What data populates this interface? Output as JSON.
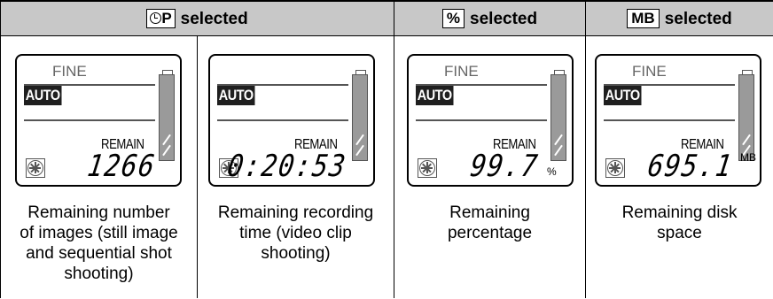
{
  "headers": [
    {
      "badge": "P",
      "badge_type": "circle-p",
      "text": "selected"
    },
    {
      "badge": "%",
      "badge_type": "box",
      "text": "selected"
    },
    {
      "badge": "MB",
      "badge_type": "box",
      "text": "selected"
    }
  ],
  "panels": [
    {
      "fine": "FINE",
      "mode": "AUTO",
      "remain": "REMAIN",
      "value": "1266",
      "unit": "",
      "caption_lines": [
        "Remaining number",
        "of images (still image",
        "and sequential shot",
        "shooting)"
      ]
    },
    {
      "fine": "",
      "mode": "AUTO",
      "remain": "REMAIN",
      "value": "0:20:53",
      "unit": "",
      "caption_lines": [
        "Remaining recording",
        "time (video clip",
        "shooting)"
      ]
    },
    {
      "fine": "FINE",
      "mode": "AUTO",
      "remain": "REMAIN",
      "value": "99.7",
      "unit": "%",
      "caption_lines": [
        "Remaining",
        "percentage"
      ]
    },
    {
      "fine": "FINE",
      "mode": "AUTO",
      "remain": "REMAIN",
      "value": "695.1",
      "unit": "MB",
      "caption_lines": [
        "Remaining disk",
        "space"
      ]
    }
  ],
  "icons": {
    "battery": "battery-icon",
    "disc": "disc-icon",
    "clock_p": "clock-p-icon"
  },
  "colors": {
    "header_bg": "#c8c8c8",
    "lcd_gray": "#9a9a9a"
  }
}
